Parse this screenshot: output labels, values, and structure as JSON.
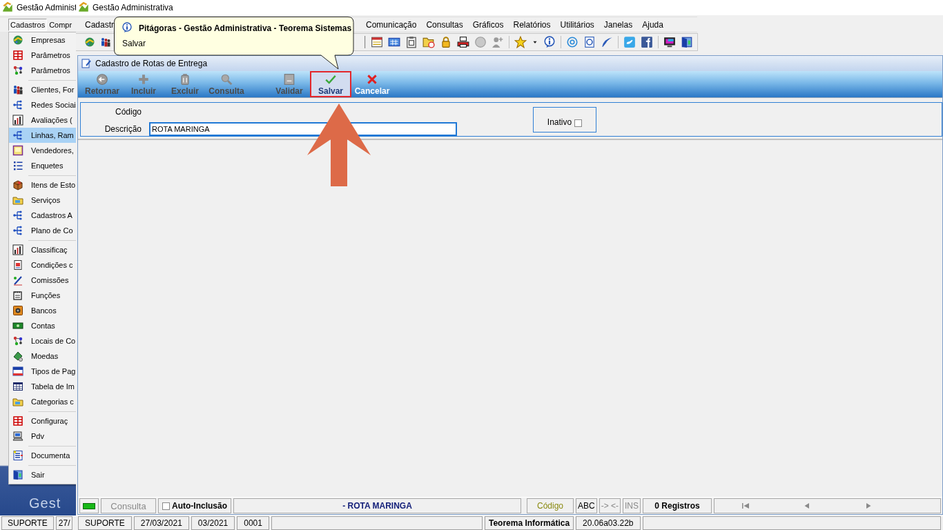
{
  "back_window": {
    "title": "Gestão Administ",
    "menu": [
      {
        "label": "Cadastros",
        "selected": true
      },
      {
        "label": "Compr",
        "selected": false
      }
    ],
    "dropdown": [
      {
        "kind": "item",
        "label": "Empresas",
        "selected": false
      },
      {
        "kind": "item",
        "label": "Parâmetros",
        "selected": false
      },
      {
        "kind": "item",
        "label": "Parâmetros",
        "selected": false
      },
      {
        "kind": "separator"
      },
      {
        "kind": "item",
        "label": "Clientes, For",
        "selected": false
      },
      {
        "kind": "item",
        "label": "Redes Sociai",
        "selected": false
      },
      {
        "kind": "item",
        "label": "Avaliações (",
        "selected": false
      },
      {
        "kind": "item",
        "label": "Linhas, Ram",
        "selected": true
      },
      {
        "kind": "item",
        "label": "Vendedores,",
        "selected": false
      },
      {
        "kind": "item",
        "label": "Enquetes",
        "selected": false
      },
      {
        "kind": "separator"
      },
      {
        "kind": "item",
        "label": "Itens de Esto",
        "selected": false
      },
      {
        "kind": "item",
        "label": "Serviços",
        "selected": false
      },
      {
        "kind": "item",
        "label": "Cadastros A",
        "selected": false
      },
      {
        "kind": "item",
        "label": "Plano de Co",
        "selected": false
      },
      {
        "kind": "separator"
      },
      {
        "kind": "item",
        "label": "Classificaç",
        "selected": false
      },
      {
        "kind": "item",
        "label": "Condições c",
        "selected": false
      },
      {
        "kind": "item",
        "label": "Comissões",
        "selected": false
      },
      {
        "kind": "item",
        "label": "Funções",
        "selected": false
      },
      {
        "kind": "item",
        "label": "Bancos",
        "selected": false
      },
      {
        "kind": "item",
        "label": "Contas",
        "selected": false
      },
      {
        "kind": "item",
        "label": "Locais de Co",
        "selected": false
      },
      {
        "kind": "item",
        "label": "Moedas",
        "selected": false
      },
      {
        "kind": "item",
        "label": "Tipos de Pag",
        "selected": false
      },
      {
        "kind": "item",
        "label": "Tabela de Im",
        "selected": false
      },
      {
        "kind": "item",
        "label": "Categorias c",
        "selected": false
      },
      {
        "kind": "separator"
      },
      {
        "kind": "item",
        "label": "Configuraç",
        "selected": false
      },
      {
        "kind": "item",
        "label": "Pdv",
        "selected": false
      },
      {
        "kind": "separator"
      },
      {
        "kind": "item",
        "label": "Documenta",
        "selected": false
      },
      {
        "kind": "separator"
      },
      {
        "kind": "item",
        "label": "Sair",
        "selected": false
      }
    ],
    "logo": "Gest",
    "status_bar": [
      "SUPORTE",
      "27/"
    ]
  },
  "main_window": {
    "title": "Gestão Administrativa",
    "menu_left": [
      "Cadastr"
    ],
    "menu_right": [
      "Comunicação",
      "Consultas",
      "Gráficos",
      "Relatórios",
      "Utilitários",
      "Janelas",
      "Ajuda"
    ],
    "status_bar": [
      {
        "kind": "field",
        "text": "SUPORTE"
      },
      {
        "kind": "field",
        "text": "27/03/2021"
      },
      {
        "kind": "field",
        "text": "03/2021"
      },
      {
        "kind": "field",
        "text": "0001"
      },
      {
        "kind": "blank"
      },
      {
        "kind": "vendor",
        "text": "Teorema Informática"
      },
      {
        "kind": "field",
        "text": "20.06a03.22b"
      },
      {
        "kind": "blank"
      }
    ]
  },
  "child_window": {
    "title": "Cadastro de Rotas de Entrega",
    "toolbar": {
      "groups": [
        [
          {
            "label": "Retornar",
            "disabled": true,
            "highlighted": false
          },
          {
            "label": "Incluir",
            "disabled": true,
            "highlighted": false
          },
          {
            "label": "Excluir",
            "disabled": true,
            "highlighted": false
          },
          {
            "label": "Consulta",
            "disabled": true,
            "highlighted": false
          }
        ],
        [
          {
            "label": "Validar",
            "disabled": true,
            "highlighted": false
          },
          {
            "label": "Salvar",
            "disabled": false,
            "highlighted": true
          },
          {
            "label": "Cancelar",
            "disabled": false,
            "highlighted": false
          }
        ]
      ]
    },
    "form": {
      "fields": [
        {
          "label": "Código"
        },
        {
          "label": "Descrição",
          "value": "ROTA MARINGA"
        }
      ],
      "inactive": {
        "label": "Inativo",
        "checked": false
      }
    },
    "status_bar": [
      {
        "kind": "indicator"
      },
      {
        "kind": "mode",
        "text": "Consulta"
      },
      {
        "kind": "checkbox",
        "text": "Auto-Inclusão",
        "checked": false
      },
      {
        "kind": "record",
        "text": "- ROTA MARINGA"
      },
      {
        "kind": "key",
        "text": "Código"
      },
      {
        "kind": "flag",
        "text": "ABC",
        "on": true
      },
      {
        "kind": "flag",
        "text": "-> <-",
        "on": false
      },
      {
        "kind": "flag",
        "text": "INS",
        "on": false
      },
      {
        "kind": "count",
        "text": "0 Registros"
      },
      {
        "kind": "nav"
      }
    ]
  },
  "tooltip": {
    "title": "Pitágoras - Gestão Administrativa - Teorema Sistemas",
    "text": "Salvar"
  }
}
